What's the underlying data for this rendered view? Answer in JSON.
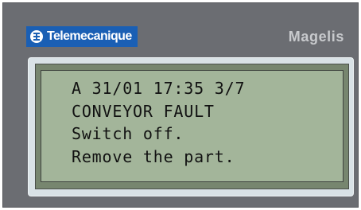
{
  "brand": {
    "name": "Telemecanique",
    "product": "Magelis"
  },
  "display": {
    "lines": [
      "A 31/01 17:35 3/7",
      "CONVEYOR FAULT",
      "Switch off.",
      "Remove the part."
    ]
  },
  "colors": {
    "panel": "#6b6d72",
    "brand_blue": "#1a5fb4",
    "lcd_background": "#a3b59a",
    "lcd_text": "#111111"
  },
  "icons": {
    "brand": "telemecanique-logo-icon"
  }
}
